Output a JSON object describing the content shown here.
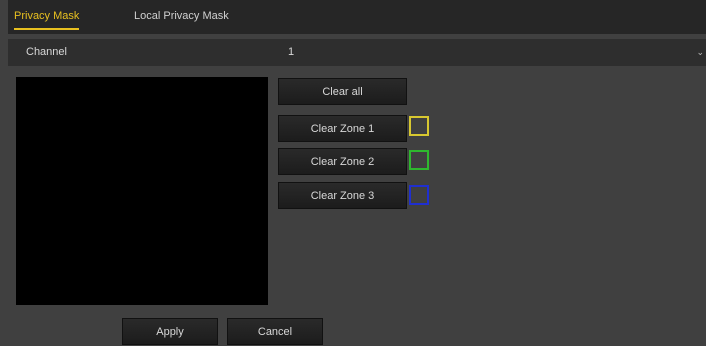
{
  "tabs": [
    {
      "label": "Privacy Mask",
      "active": true
    },
    {
      "label": "Local Privacy Mask",
      "active": false
    }
  ],
  "channel": {
    "label": "Channel",
    "value": "1"
  },
  "buttons": {
    "clear_all": "Clear all",
    "apply": "Apply",
    "cancel": "Cancel"
  },
  "zones": [
    {
      "label": "Clear Zone 1",
      "color": "#d8c830"
    },
    {
      "label": "Clear Zone 2",
      "color": "#2eb82e"
    },
    {
      "label": "Clear Zone 3",
      "color": "#1f2fd0"
    }
  ],
  "colors": {
    "accent": "#e8c020",
    "background": "#404040"
  }
}
